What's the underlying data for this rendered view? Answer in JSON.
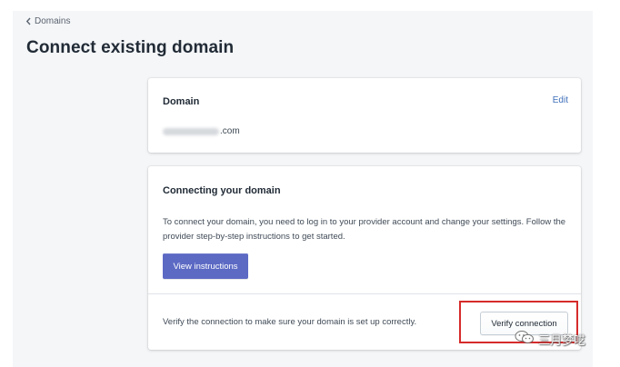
{
  "breadcrumb": {
    "label": "Domains"
  },
  "page": {
    "title": "Connect existing domain"
  },
  "domain_card": {
    "heading": "Domain",
    "edit_label": "Edit",
    "domain_suffix": ".com"
  },
  "connect_card": {
    "heading": "Connecting your domain",
    "instructions": "To connect your domain, you need to log in to your provider account and change your settings. Follow the provider step-by-step instructions to get started.",
    "view_button_label": "View instructions",
    "verify_text": "Verify the connection to make sure your domain is set up correctly.",
    "verify_button_label": "Verify connection"
  },
  "watermark": {
    "text": "三月梦呓",
    "icon": "wechat-icon"
  },
  "colors": {
    "primary": "#5c6ac4",
    "link": "#3f6fba",
    "highlight": "#d62b2b",
    "page_background": "#f4f6f8"
  }
}
